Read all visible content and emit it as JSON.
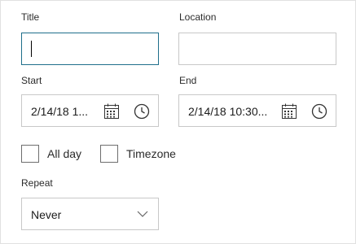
{
  "form": {
    "title_label": "Title",
    "title_value": "",
    "location_label": "Location",
    "location_value": "",
    "start_label": "Start",
    "start_value": "2/14/18 1...",
    "end_label": "End",
    "end_value": "2/14/18 10:30...",
    "allday_label": "All day",
    "allday_checked": false,
    "timezone_label": "Timezone",
    "timezone_checked": false,
    "repeat_label": "Repeat",
    "repeat_value": "Never"
  },
  "icons": {
    "date": "calendar-icon",
    "time": "clock-icon",
    "dropdown": "chevron-down-icon"
  },
  "colors": {
    "focus_border": "#1f6f8b",
    "field_border": "#c8c8c8",
    "checkbox_border": "#6e6e6e"
  }
}
